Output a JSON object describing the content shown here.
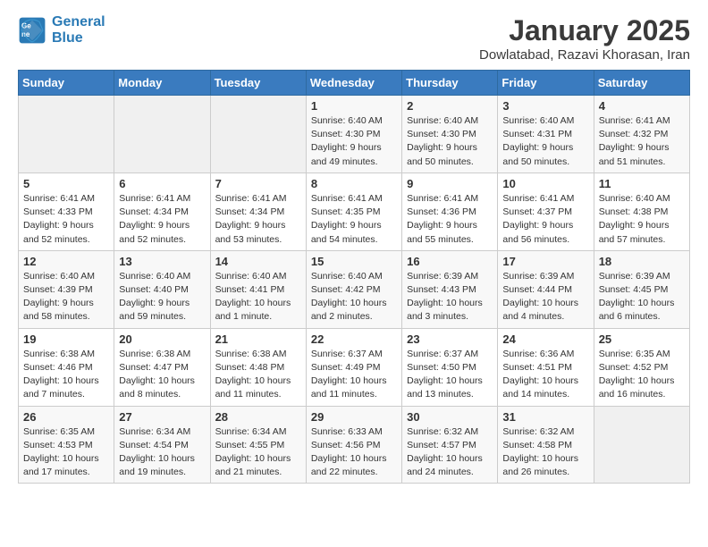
{
  "header": {
    "logo_line1": "General",
    "logo_line2": "Blue",
    "month": "January 2025",
    "location": "Dowlatabad, Razavi Khorasan, Iran"
  },
  "weekdays": [
    "Sunday",
    "Monday",
    "Tuesday",
    "Wednesday",
    "Thursday",
    "Friday",
    "Saturday"
  ],
  "weeks": [
    [
      {
        "day": "",
        "info": ""
      },
      {
        "day": "",
        "info": ""
      },
      {
        "day": "",
        "info": ""
      },
      {
        "day": "1",
        "info": "Sunrise: 6:40 AM\nSunset: 4:30 PM\nDaylight: 9 hours\nand 49 minutes."
      },
      {
        "day": "2",
        "info": "Sunrise: 6:40 AM\nSunset: 4:30 PM\nDaylight: 9 hours\nand 50 minutes."
      },
      {
        "day": "3",
        "info": "Sunrise: 6:40 AM\nSunset: 4:31 PM\nDaylight: 9 hours\nand 50 minutes."
      },
      {
        "day": "4",
        "info": "Sunrise: 6:41 AM\nSunset: 4:32 PM\nDaylight: 9 hours\nand 51 minutes."
      }
    ],
    [
      {
        "day": "5",
        "info": "Sunrise: 6:41 AM\nSunset: 4:33 PM\nDaylight: 9 hours\nand 52 minutes."
      },
      {
        "day": "6",
        "info": "Sunrise: 6:41 AM\nSunset: 4:34 PM\nDaylight: 9 hours\nand 52 minutes."
      },
      {
        "day": "7",
        "info": "Sunrise: 6:41 AM\nSunset: 4:34 PM\nDaylight: 9 hours\nand 53 minutes."
      },
      {
        "day": "8",
        "info": "Sunrise: 6:41 AM\nSunset: 4:35 PM\nDaylight: 9 hours\nand 54 minutes."
      },
      {
        "day": "9",
        "info": "Sunrise: 6:41 AM\nSunset: 4:36 PM\nDaylight: 9 hours\nand 55 minutes."
      },
      {
        "day": "10",
        "info": "Sunrise: 6:41 AM\nSunset: 4:37 PM\nDaylight: 9 hours\nand 56 minutes."
      },
      {
        "day": "11",
        "info": "Sunrise: 6:40 AM\nSunset: 4:38 PM\nDaylight: 9 hours\nand 57 minutes."
      }
    ],
    [
      {
        "day": "12",
        "info": "Sunrise: 6:40 AM\nSunset: 4:39 PM\nDaylight: 9 hours\nand 58 minutes."
      },
      {
        "day": "13",
        "info": "Sunrise: 6:40 AM\nSunset: 4:40 PM\nDaylight: 9 hours\nand 59 minutes."
      },
      {
        "day": "14",
        "info": "Sunrise: 6:40 AM\nSunset: 4:41 PM\nDaylight: 10 hours\nand 1 minute."
      },
      {
        "day": "15",
        "info": "Sunrise: 6:40 AM\nSunset: 4:42 PM\nDaylight: 10 hours\nand 2 minutes."
      },
      {
        "day": "16",
        "info": "Sunrise: 6:39 AM\nSunset: 4:43 PM\nDaylight: 10 hours\nand 3 minutes."
      },
      {
        "day": "17",
        "info": "Sunrise: 6:39 AM\nSunset: 4:44 PM\nDaylight: 10 hours\nand 4 minutes."
      },
      {
        "day": "18",
        "info": "Sunrise: 6:39 AM\nSunset: 4:45 PM\nDaylight: 10 hours\nand 6 minutes."
      }
    ],
    [
      {
        "day": "19",
        "info": "Sunrise: 6:38 AM\nSunset: 4:46 PM\nDaylight: 10 hours\nand 7 minutes."
      },
      {
        "day": "20",
        "info": "Sunrise: 6:38 AM\nSunset: 4:47 PM\nDaylight: 10 hours\nand 8 minutes."
      },
      {
        "day": "21",
        "info": "Sunrise: 6:38 AM\nSunset: 4:48 PM\nDaylight: 10 hours\nand 11 minutes."
      },
      {
        "day": "22",
        "info": "Sunrise: 6:37 AM\nSunset: 4:49 PM\nDaylight: 10 hours\nand 11 minutes."
      },
      {
        "day": "23",
        "info": "Sunrise: 6:37 AM\nSunset: 4:50 PM\nDaylight: 10 hours\nand 13 minutes."
      },
      {
        "day": "24",
        "info": "Sunrise: 6:36 AM\nSunset: 4:51 PM\nDaylight: 10 hours\nand 14 minutes."
      },
      {
        "day": "25",
        "info": "Sunrise: 6:35 AM\nSunset: 4:52 PM\nDaylight: 10 hours\nand 16 minutes."
      }
    ],
    [
      {
        "day": "26",
        "info": "Sunrise: 6:35 AM\nSunset: 4:53 PM\nDaylight: 10 hours\nand 17 minutes."
      },
      {
        "day": "27",
        "info": "Sunrise: 6:34 AM\nSunset: 4:54 PM\nDaylight: 10 hours\nand 19 minutes."
      },
      {
        "day": "28",
        "info": "Sunrise: 6:34 AM\nSunset: 4:55 PM\nDaylight: 10 hours\nand 21 minutes."
      },
      {
        "day": "29",
        "info": "Sunrise: 6:33 AM\nSunset: 4:56 PM\nDaylight: 10 hours\nand 22 minutes."
      },
      {
        "day": "30",
        "info": "Sunrise: 6:32 AM\nSunset: 4:57 PM\nDaylight: 10 hours\nand 24 minutes."
      },
      {
        "day": "31",
        "info": "Sunrise: 6:32 AM\nSunset: 4:58 PM\nDaylight: 10 hours\nand 26 minutes."
      },
      {
        "day": "",
        "info": ""
      }
    ]
  ]
}
